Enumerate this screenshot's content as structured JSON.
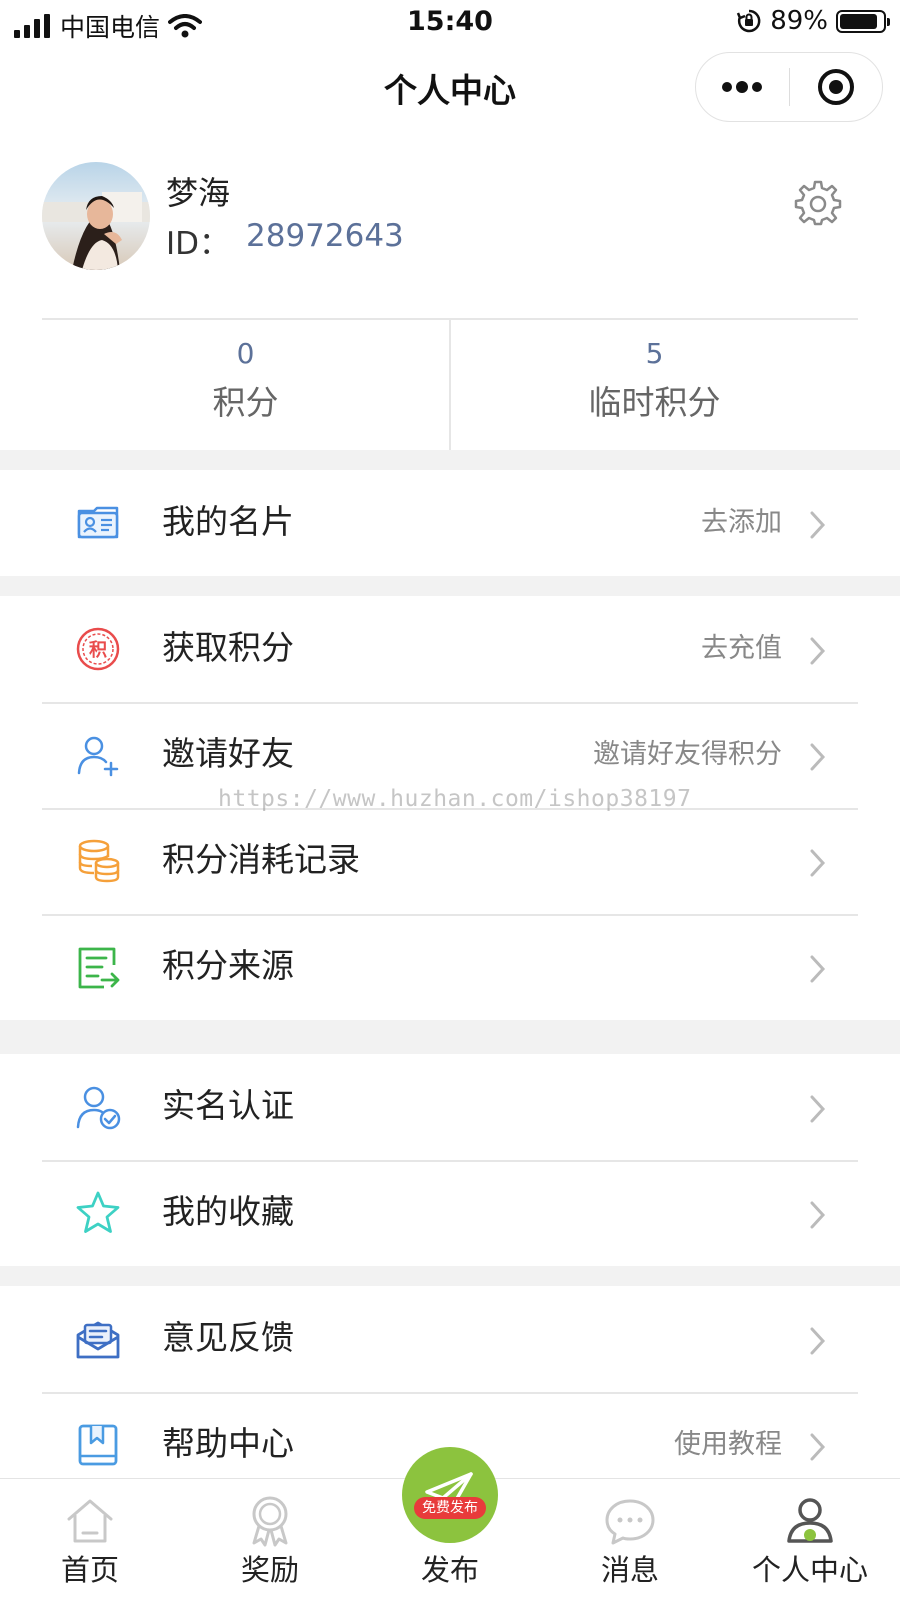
{
  "status_bar": {
    "carrier": "中国电信",
    "time": "15:40",
    "battery_percent": "89%",
    "battery_level": 0.89
  },
  "nav": {
    "title": "个人中心",
    "more_icon": "more-dots-icon",
    "close_icon": "target-close-icon"
  },
  "profile": {
    "name": "梦海",
    "id_label": "ID：",
    "id_value": "28972643",
    "avatar_icon": "user-avatar-photo",
    "settings_icon": "gear-icon"
  },
  "stats": [
    {
      "value": "0",
      "label": "积分"
    },
    {
      "value": "5",
      "label": "临时积分"
    }
  ],
  "menu_groups": [
    {
      "items": [
        {
          "label": "我的名片",
          "right": "去添加",
          "icon": "business-card-icon",
          "color": "#4a90e2"
        }
      ]
    },
    {
      "items": [
        {
          "label": "获取积分",
          "right": "去充值",
          "icon": "points-stamp-icon",
          "color": "#e94c4c"
        },
        {
          "label": "邀请好友",
          "right": "邀请好友得积分",
          "icon": "add-user-icon",
          "color": "#4a90e2"
        },
        {
          "label": "积分消耗记录",
          "right": "",
          "icon": "coin-stack-icon",
          "color": "#f5a03a"
        },
        {
          "label": "积分来源",
          "right": "",
          "icon": "list-export-icon",
          "color": "#3cb54a"
        }
      ]
    },
    {
      "items": [
        {
          "label": "实名认证",
          "right": "",
          "icon": "verified-user-icon",
          "color": "#4a90e2"
        },
        {
          "label": "我的收藏",
          "right": "",
          "icon": "star-icon",
          "color": "#3dd1c4"
        }
      ]
    },
    {
      "items": [
        {
          "label": "意见反馈",
          "right": "",
          "icon": "feedback-mail-icon",
          "color": "#3e6fc4"
        },
        {
          "label": "帮助中心",
          "right": "使用教程",
          "icon": "help-book-icon",
          "color": "#4a9be2"
        }
      ]
    }
  ],
  "watermark": "https://www.huzhan.com/ishop38197",
  "tab_bar": {
    "tabs": [
      {
        "label": "首页",
        "icon": "home-icon",
        "active": false
      },
      {
        "label": "奖励",
        "icon": "medal-icon",
        "active": false
      },
      {
        "label": "发布",
        "icon": "paper-plane-icon",
        "active": false,
        "badge": "免费发布"
      },
      {
        "label": "消息",
        "icon": "chat-bubble-icon",
        "active": false
      },
      {
        "label": "个人中心",
        "icon": "user-profile-icon",
        "active": true
      }
    ]
  },
  "colors": {
    "accent_blue_text": "#5c7199",
    "publish_green": "#8cc33e",
    "badge_red": "#e83b3b",
    "page_background": "#f2f2f2"
  }
}
